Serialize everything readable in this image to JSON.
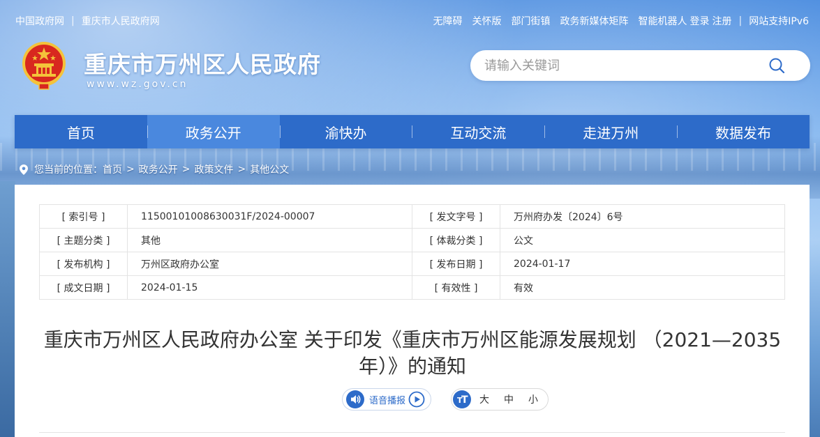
{
  "topbar": {
    "left_links": [
      "中国政府网",
      "重庆市人民政府网"
    ],
    "right_links": [
      "无障碍",
      "关怀版",
      "部门街镇",
      "政务新媒体矩阵",
      "智能机器人"
    ],
    "login": "登录",
    "register": "注册",
    "ipv6": "网站支持IPv6"
  },
  "header": {
    "title": "重庆市万州区人民政府",
    "url": "www.wz.gov.cn"
  },
  "search": {
    "placeholder": "请输入关键词"
  },
  "nav": {
    "items": [
      "首页",
      "政务公开",
      "渝快办",
      "互动交流",
      "走进万州",
      "数据发布"
    ],
    "active_index": 1
  },
  "breadcrumb": {
    "prefix": "您当前的位置：",
    "items": [
      "首页",
      "政务公开",
      "政策文件",
      "其他公文"
    ]
  },
  "meta": {
    "rows": [
      [
        {
          "label": "[ 索引号 ]",
          "value": "11500101008630031F/2024-00007"
        },
        {
          "label": "[ 发文字号 ]",
          "value": "万州府办发〔2024〕6号"
        }
      ],
      [
        {
          "label": "[ 主题分类 ]",
          "value": "其他"
        },
        {
          "label": "[ 体裁分类 ]",
          "value": "公文"
        }
      ],
      [
        {
          "label": "[ 发布机构 ]",
          "value": "万州区政府办公室"
        },
        {
          "label": "[ 发布日期 ]",
          "value": "2024-01-17"
        }
      ],
      [
        {
          "label": "[ 成文日期 ]",
          "value": "2024-01-15"
        },
        {
          "label": "[ 有效性 ]",
          "value": "有效"
        }
      ]
    ]
  },
  "document": {
    "title_line1": "重庆市万州区人民政府办公室 关于印发《重庆市万州区能源发展规划 （2021—2035",
    "title_line2": "年）》的通知"
  },
  "tools": {
    "audio_label": "语音播报",
    "font_options": [
      "大",
      "中",
      "小"
    ]
  },
  "colors": {
    "nav_bg": "#2d6bc9",
    "nav_active": "#4a88de",
    "accent": "#2d6bc9"
  }
}
